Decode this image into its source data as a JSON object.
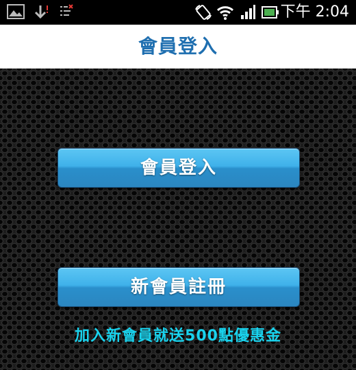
{
  "status_bar": {
    "icons": [
      "gallery-icon",
      "download-icon",
      "debug-icon",
      "rotate-icon",
      "wifi-icon",
      "signal-icon",
      "battery-icon"
    ],
    "time": "下午 2:04"
  },
  "header": {
    "title": "會員登入"
  },
  "main": {
    "login_button": "會員登入",
    "register_button": "新會員註冊",
    "promo_text": "加入新會員就送500點優惠金"
  },
  "colors": {
    "title": "#1f6fb0",
    "button": "#3fb1ea",
    "promo": "#19d3ee"
  }
}
